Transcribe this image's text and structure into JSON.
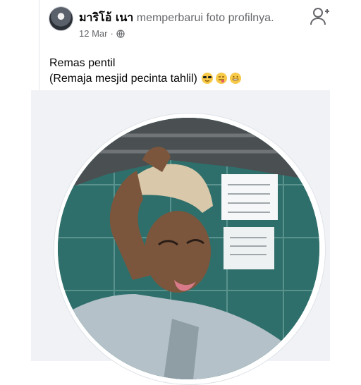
{
  "post": {
    "author": "มาริโอ้ เนา",
    "action": "memperbarui foto profilnya.",
    "date": "12 Mar",
    "dot": "·",
    "text_line1": "Remas pentil",
    "text_line2": "(Remaja mesjid pecinta tahlil)"
  },
  "icons": {
    "avatar": "avatar",
    "privacy": "globe-icon",
    "add_friend": "add-friend-icon",
    "emojis": [
      "sunglasses-emoji",
      "tongue-wink-emoji",
      "grin-emoji"
    ]
  },
  "colors": {
    "text_primary": "#050505",
    "text_secondary": "#65676b",
    "photo_background": "#f0f2f5",
    "tile_teal": "#2f6f6b"
  }
}
